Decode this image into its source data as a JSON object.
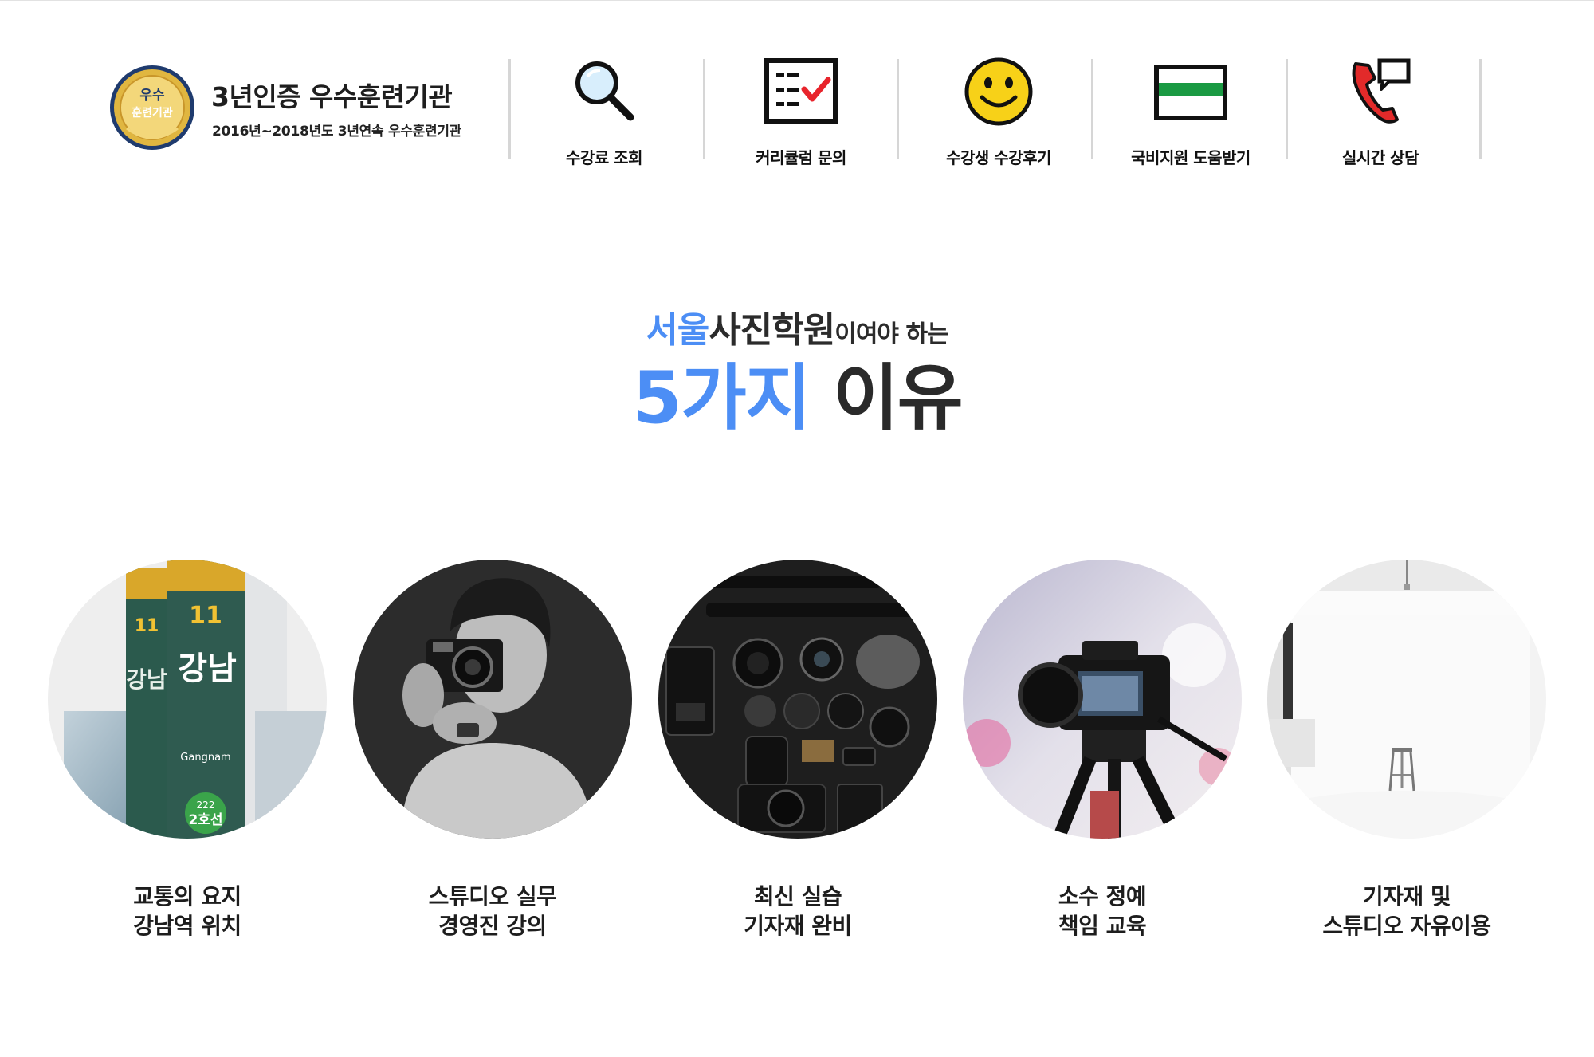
{
  "header": {
    "badge_text": [
      "우수",
      "훈련기관"
    ],
    "brand_title": "3년인증 우수훈련기관",
    "brand_subtitle": "2016년~2018년도 3년연속 우수훈련기관",
    "nav": [
      {
        "label": "수강료 조회",
        "icon": "magnifier-icon"
      },
      {
        "label": "커리큘럼 문의",
        "icon": "checklist-icon"
      },
      {
        "label": "수강생 수강후기",
        "icon": "smiley-icon"
      },
      {
        "label": "국비지원 도움받기",
        "icon": "card-icon"
      },
      {
        "label": "실시간 상담",
        "icon": "phone-chat-icon"
      }
    ]
  },
  "hero": {
    "line1_blue": "서울",
    "line1_dark": "사진학원",
    "line1_small": "이여야 하는",
    "line2_blue": "5가지",
    "line2_dark": "이유"
  },
  "reasons": [
    {
      "line1": "교통의 요지",
      "line2": "강남역 위치",
      "image": "gangnam-station-sign"
    },
    {
      "line1": "스튜디오 실무",
      "line2": "경영진 강의",
      "image": "photographer-portrait"
    },
    {
      "line1": "최신 실습",
      "line2": "기자재 완비",
      "image": "camera-equipment-flatlay"
    },
    {
      "line1": "소수 정예",
      "line2": "책임 교육",
      "image": "camera-on-tripod"
    },
    {
      "line1": "기자재 및",
      "line2": "스튜디오 자유이용",
      "image": "white-studio-stool"
    }
  ],
  "station_sign": {
    "line": "11",
    "name": "강남",
    "roman": "Gangnam",
    "number": "222",
    "line_name": "2호선"
  },
  "colors": {
    "accent_blue": "#4c8ef5",
    "text_dark": "#2a2a2a",
    "badge_gold": "#d4a62a",
    "badge_navy": "#1f3b6e"
  }
}
